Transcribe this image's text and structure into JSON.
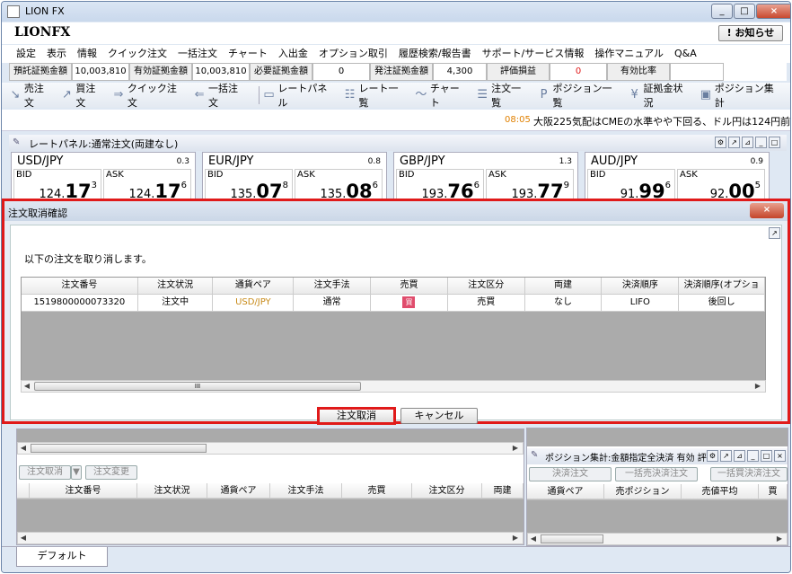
{
  "app": {
    "title": "LION FX",
    "logo": "LIONFX",
    "notify": "! お知らせ"
  },
  "window_controls": [
    "_",
    "□",
    "×"
  ],
  "menu": [
    "設定",
    "表示",
    "情報",
    "クイック注文",
    "一括注文",
    "チャート",
    "入出金",
    "オプション取引",
    "履歴検索/報告書",
    "サポート/サービス情報",
    "操作マニュアル",
    "Q&A"
  ],
  "margin": [
    {
      "label": "預託証拠金額",
      "value": "10,003,810"
    },
    {
      "label": "有効証拠金額",
      "value": "10,003,810"
    },
    {
      "label": "必要証拠金額",
      "value": "0"
    },
    {
      "label": "発注証拠金額",
      "value": "4,300"
    },
    {
      "label": "評価損益",
      "value": "0"
    },
    {
      "label": "有効比率",
      "value": ""
    }
  ],
  "toolbar": [
    {
      "icon": "sell-order-icon",
      "glyph": "↘",
      "label": "売注文"
    },
    {
      "icon": "buy-order-icon",
      "glyph": "↗",
      "label": "買注文"
    },
    {
      "icon": "quick-order-icon",
      "glyph": "⇒",
      "label": "クイック注文"
    },
    {
      "icon": "bulk-order-icon",
      "glyph": "⇐",
      "label": "一括注文"
    },
    {
      "icon": "rate-panel-icon",
      "glyph": "▭",
      "label": "レートパネル"
    },
    {
      "icon": "rate-list-icon",
      "glyph": "☷",
      "label": "レート一覧"
    },
    {
      "icon": "chart-icon",
      "glyph": "〜",
      "label": "チャート"
    },
    {
      "icon": "order-list-icon",
      "glyph": "☰",
      "label": "注文一覧"
    },
    {
      "icon": "position-list-icon",
      "glyph": "P",
      "label": "ポジション一覧"
    },
    {
      "icon": "margin-status-icon",
      "glyph": "¥",
      "label": "証拠金状況"
    },
    {
      "icon": "position-summary-icon",
      "glyph": "▣",
      "label": "ポジション集計"
    }
  ],
  "ticker": {
    "time": "08:05",
    "text": "大阪225気配はCMEの水準やや下回る、ドル円は124円前半"
  },
  "rate_panel": {
    "title": "レートパネル:通常注文(両建なし)",
    "pairs": [
      {
        "name": "USD/JPY",
        "spread": "0.3",
        "bid": {
          "pre": "124.",
          "big": "17",
          "sup": "3"
        },
        "ask": {
          "pre": "124.",
          "big": "17",
          "sup": "6"
        }
      },
      {
        "name": "EUR/JPY",
        "spread": "0.8",
        "bid": {
          "pre": "135.",
          "big": "07",
          "sup": "8"
        },
        "ask": {
          "pre": "135.",
          "big": "08",
          "sup": "6"
        }
      },
      {
        "name": "GBP/JPY",
        "spread": "1.3",
        "bid": {
          "pre": "193.",
          "big": "76",
          "sup": "6"
        },
        "ask": {
          "pre": "193.",
          "big": "77",
          "sup": "9"
        }
      },
      {
        "name": "AUD/JPY",
        "spread": "0.9",
        "bid": {
          "pre": "91.",
          "big": "99",
          "sup": "6"
        },
        "ask": {
          "pre": "92.",
          "big": "00",
          "sup": "5"
        }
      }
    ],
    "bid_label": "BID",
    "ask_label": "ASK"
  },
  "dialog": {
    "title": "注文取消確認",
    "close": "×",
    "message": "以下の注文を取り消します。",
    "columns": [
      "注文番号",
      "注文状況",
      "通貨ペア",
      "注文手法",
      "売買",
      "注文区分",
      "両建",
      "決済順序",
      "決済順序(オプショ"
    ],
    "rows": [
      [
        "1519800000073320",
        "注文中",
        "USD/JPY",
        "通常",
        "買",
        "売買",
        "なし",
        "LIFO",
        "後回し"
      ]
    ],
    "confirm": "注文取消",
    "cancel": "キャンセル"
  },
  "order_panel": {
    "cancel_btn": "注文取消",
    "change_btn": "注文変更",
    "columns": [
      "注文番号",
      "注文状況",
      "通貨ペア",
      "注文手法",
      "売買",
      "注文区分",
      "両建"
    ]
  },
  "position_panel": {
    "title": "ポジション集計:金額指定全決済 有効 評価",
    "settle_btn": "決済注文",
    "bulk_sell_btn": "一括売決済注文",
    "bulk_buy_btn": "一括買決済注文",
    "columns": [
      "通貨ペア",
      "売ポジション",
      "売値平均",
      "買"
    ]
  },
  "tab": "デフォルト"
}
